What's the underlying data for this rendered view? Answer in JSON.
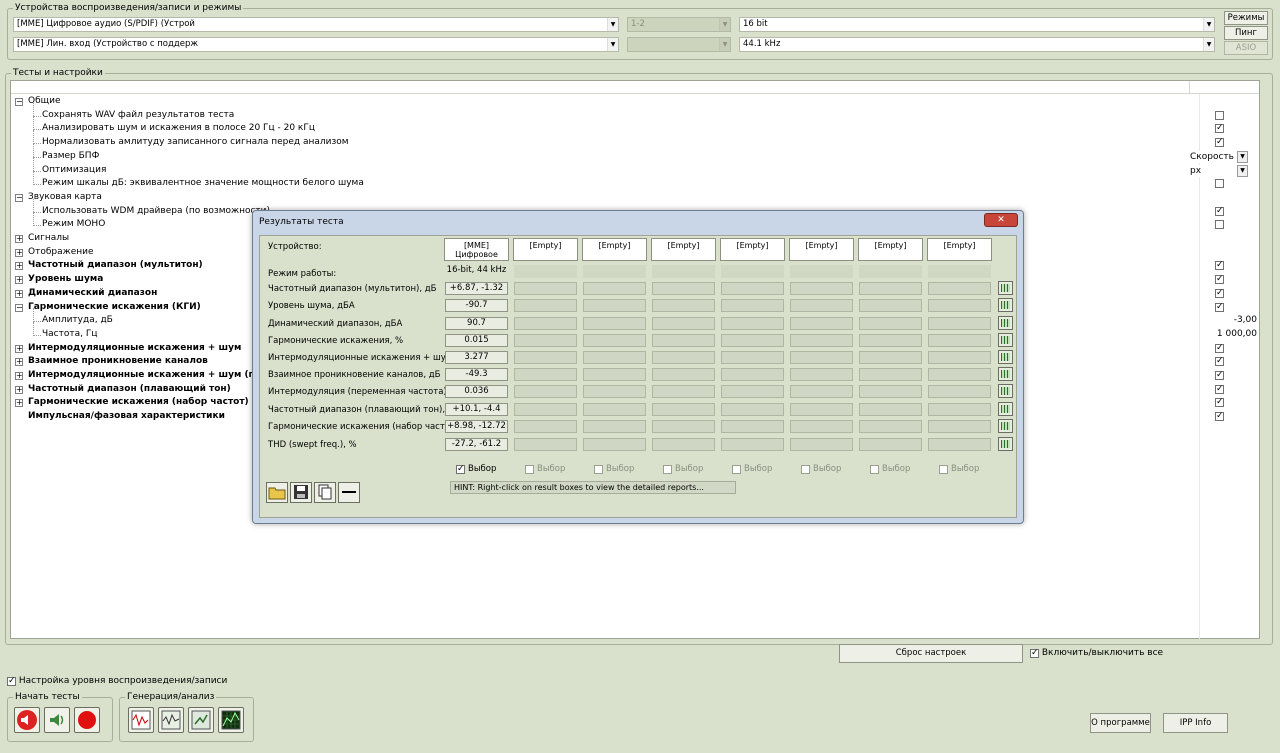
{
  "devices": {
    "group_title": "Устройства воспроизведения/записи и режимы",
    "playback_device": "[MME] Цифровое аудио (S/PDIF) (Устрой",
    "record_device": "[MME] Лин. вход (Устройство с поддерж",
    "channels": "1-2",
    "channels2": "",
    "bit_depth": "16 bit",
    "sample_rate": "44.1 kHz",
    "btn_modes": "Режимы",
    "btn_ping": "Пинг",
    "btn_asio": "ASIO"
  },
  "tests": {
    "group_title": "Тесты и настройки",
    "rows": [
      {
        "label": "Общие",
        "level": 0,
        "exp": "−",
        "bold": false
      },
      {
        "label": "Сохранять WAV файл результатов теста",
        "level": 1,
        "check": false
      },
      {
        "label": "Анализировать шум и искажения в полосе 20 Гц - 20 кГц",
        "level": 1,
        "check": true
      },
      {
        "label": "Нормализовать амлитуду записанного сигнала перед анализом",
        "level": 1,
        "check": true
      },
      {
        "label": "Размер БПФ",
        "level": 1,
        "select": "Скорость"
      },
      {
        "label": "Оптимизация",
        "level": 1,
        "select": "px"
      },
      {
        "label": "Режим шкалы дБ: эквивалентное значение мощности белого шума",
        "level": 1,
        "check": false
      },
      {
        "label": "Звуковая карта",
        "level": 0,
        "exp": "−",
        "bold": false
      },
      {
        "label": "Использовать WDM драйвера (по возможности)",
        "level": 1,
        "check": true
      },
      {
        "label": "Режим МОНО",
        "level": 1,
        "check": false
      },
      {
        "label": "Сигналы",
        "level": 0,
        "exp": "+",
        "bold": false
      },
      {
        "label": "Отображение",
        "level": 0,
        "exp": "+",
        "bold": false
      },
      {
        "label": "Частотный диапазон (мультитон)",
        "level": 0,
        "exp": "+",
        "bold": true,
        "check": true
      },
      {
        "label": "Уровень шума",
        "level": 0,
        "exp": "+",
        "bold": true,
        "check": true
      },
      {
        "label": "Динамический диапазон",
        "level": 0,
        "exp": "+",
        "bold": true,
        "check": true
      },
      {
        "label": "Гармонические искажения (КГИ)",
        "level": 0,
        "exp": "−",
        "bold": true,
        "check": true
      },
      {
        "label": "Амплитуда, дБ",
        "level": 1,
        "value": "-3,00"
      },
      {
        "label": "Частота, Гц",
        "level": 1,
        "value": "1 000,00"
      },
      {
        "label": "Интермодуляционные искажения + шум",
        "level": 0,
        "exp": "+",
        "bold": true,
        "check": true
      },
      {
        "label": "Взаимное проникновение каналов",
        "level": 0,
        "exp": "+",
        "bold": true,
        "check": true
      },
      {
        "label": "Интермодуляционные искажения + шум (пере",
        "level": 0,
        "exp": "+",
        "bold": true,
        "check": true
      },
      {
        "label": "Частотный диапазон (плавающий тон)",
        "level": 0,
        "exp": "+",
        "bold": true,
        "check": true
      },
      {
        "label": "Гармонические искажения (набор частот)",
        "level": 0,
        "exp": "+",
        "bold": true,
        "check": true
      },
      {
        "label": "Импульсная/фазовая характеристики",
        "level": 0,
        "exp": "",
        "bold": true,
        "check": true
      }
    ]
  },
  "reset_button": "Сброс настроек",
  "toggle_all_label": "Включить/выключить все",
  "level_setup_label": "Настройка уровня воспроизведения/записи",
  "start_tests_title": "Начать тесты",
  "gen_analysis_title": "Генерация/анализ",
  "about_button": "О программе",
  "ipp_button": "IPP Info",
  "dialog": {
    "title": "Результаты теста",
    "close": "✕",
    "device_label": "Устройство:",
    "mode_label": "Режим работы:",
    "columns": [
      "[MME]\nЦифровое",
      "[Empty]",
      "[Empty]",
      "[Empty]",
      "[Empty]",
      "[Empty]",
      "[Empty]",
      "[Empty]"
    ],
    "mode_value": "16-bit, 44 kHz",
    "metrics": [
      {
        "label": "Частотный диапазон (мультитон), дБ",
        "value": "+6.87, -1.32"
      },
      {
        "label": "Уровень шума, дБА",
        "value": "-90.7"
      },
      {
        "label": "Динамический диапазон, дБА",
        "value": "90.7"
      },
      {
        "label": "Гармонические искажения, %",
        "value": "0.015"
      },
      {
        "label": "Интермодуляционные искажения + шум, %",
        "value": "3.277"
      },
      {
        "label": "Взаимное проникновение каналов, дБ",
        "value": "-49.3"
      },
      {
        "label": "Интермодуляция (переменная частота), %",
        "value": "0.036"
      },
      {
        "label": "Частотный диапазон (плавающий тон), дБ",
        "value": "+10.1, -4.4"
      },
      {
        "label": "Гармонические искажения (набор частот)",
        "value": "+8.98, -12.72"
      },
      {
        "label": "THD (swept freq.), %",
        "value": "-27.2, -61.2"
      }
    ],
    "select_label": "Выбор",
    "hint": "HINT: Right-click on result boxes to view the detailed reports..."
  }
}
